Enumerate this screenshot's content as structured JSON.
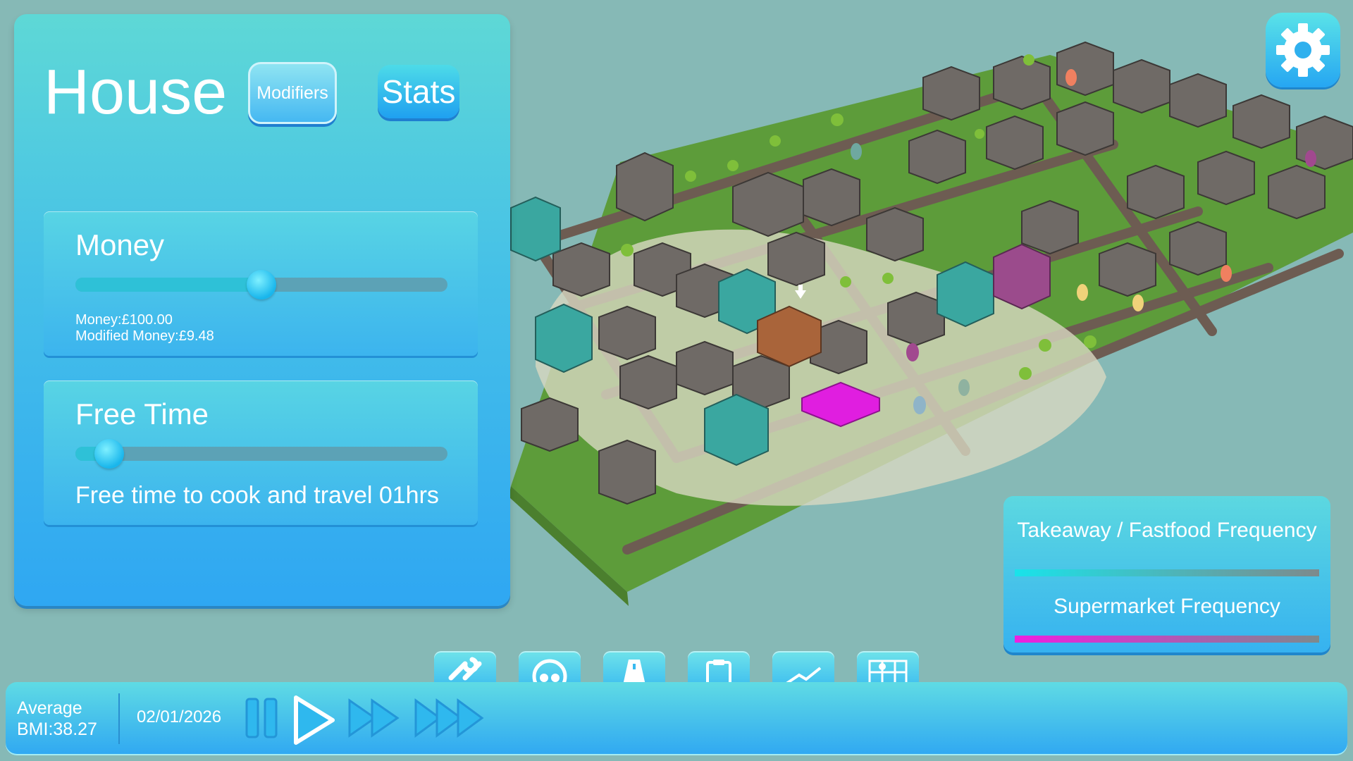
{
  "panel": {
    "title": "House",
    "tabs": {
      "modifiers": "Modifiers",
      "stats": "Stats"
    },
    "money": {
      "title": "Money",
      "slider_level": 0.5,
      "value_line": "Money:£100.00",
      "modified_line": "Modified Money:£9.48"
    },
    "free_time": {
      "title": "Free Time",
      "slider_level": 0.09,
      "description": "Free time to cook and travel 01hrs"
    }
  },
  "frequency": {
    "takeaway_label": "Takeaway / Fastfood Frequency",
    "supermarket_label": "Supermarket Frequency",
    "takeaway_color": "#19e3ea",
    "supermarket_color": "#ee1ee0"
  },
  "toolbar": {
    "tools": [
      "wrench-icon",
      "food-icon",
      "road-icon",
      "clipboard-icon",
      "graph-icon",
      "map-icon"
    ]
  },
  "status": {
    "bmi_label": "Average",
    "bmi_value": "BMI:38.27",
    "date": "02/01/2026"
  },
  "colors": {
    "background": "#86b9b6",
    "panel_accent": "#2fa7f2",
    "grass": "#5d9c3a",
    "house_grey": "#6f6a66",
    "house_teal": "#3aa7a0",
    "house_selected": "#a9643a",
    "house_purple": "#9b4b8c",
    "shop_magenta": "#e01ee0"
  }
}
